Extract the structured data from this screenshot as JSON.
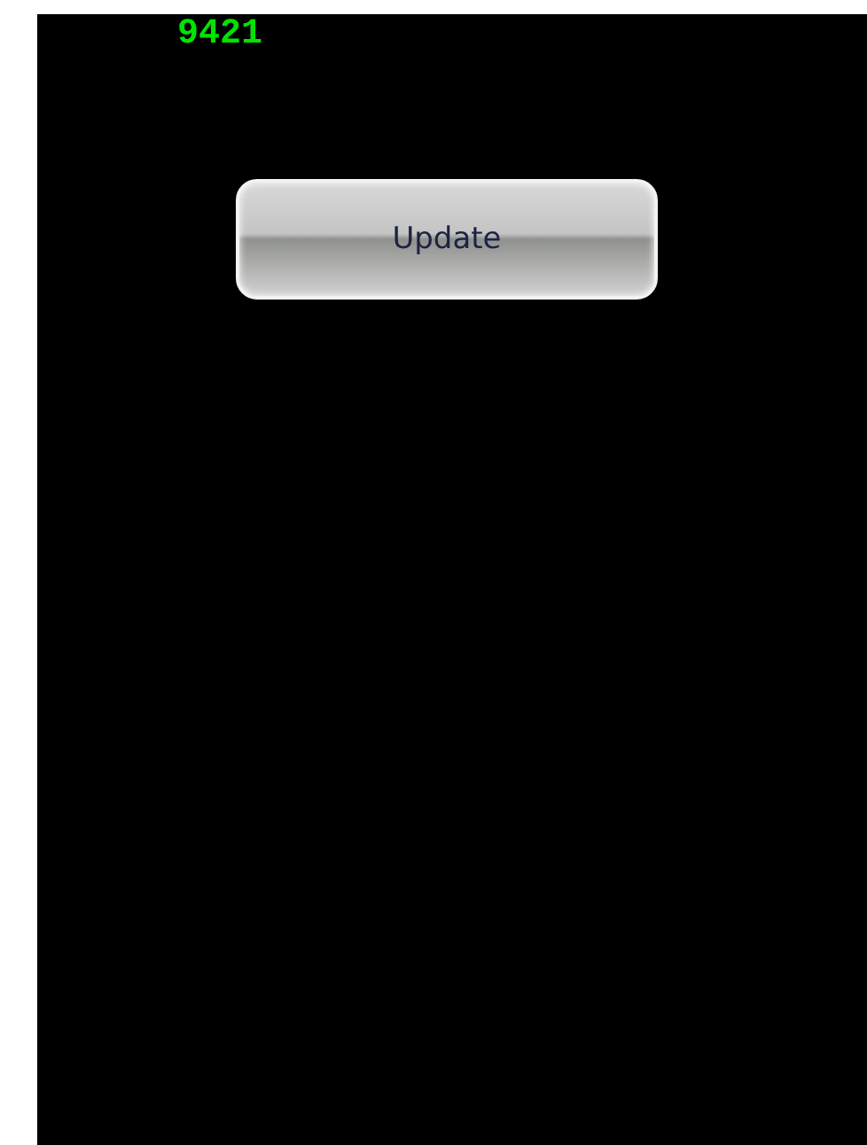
{
  "counter": "9421",
  "button": {
    "label": "Update"
  }
}
